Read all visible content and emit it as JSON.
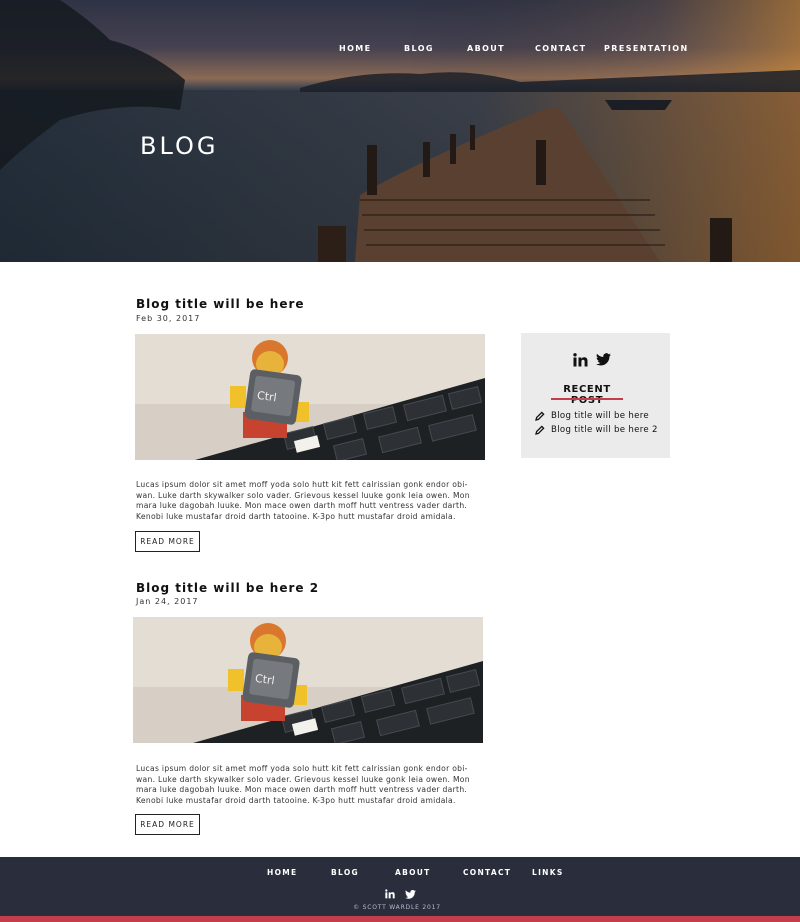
{
  "nav": {
    "items": [
      "HOME",
      "BLOG",
      "ABOUT",
      "CONTACT",
      "PRESENTATION"
    ]
  },
  "hero": {
    "title": "BLOG"
  },
  "posts": [
    {
      "title": "Blog title will be here",
      "date": "Feb 30, 2017",
      "text": "Lucas ipsum dolor sit amet moff yoda solo hutt kit fett calrissian gonk endor obi-wan. Luke darth skywalker solo vader. Grievous kessel luuke gonk leia owen. Mon mara luke dagobah luuke. Mon mace owen darth moff hutt ventress vader darth. Kenobi luke mustafar droid darth tatooine. K-3po hutt mustafar droid amidala.",
      "button": "READ MORE"
    },
    {
      "title": "Blog title will be here 2",
      "date": "Jan 24, 2017",
      "text": "Lucas ipsum dolor sit amet moff yoda solo hutt kit fett calrissian gonk endor obi-wan. Luke darth skywalker solo vader. Grievous kessel luuke gonk leia owen. Mon mara luke dagobah luuke. Mon mace owen darth moff hutt ventress vader darth. Kenobi luke mustafar droid darth tatooine. K-3po hutt mustafar droid amidala.",
      "button": "READ MORE"
    }
  ],
  "sidebar": {
    "icons": [
      "linkedin-icon",
      "twitter-icon"
    ],
    "heading": "RECENT POST",
    "items": [
      "Blog title will be here",
      "Blog title will be here 2"
    ]
  },
  "footer": {
    "nav": [
      "HOME",
      "BLOG",
      "ABOUT",
      "CONTACT",
      "LINKS"
    ],
    "icons": [
      "linkedin-icon",
      "twitter-icon"
    ],
    "copyright": "© SCOTT WARDLE 2017"
  },
  "colors": {
    "accent": "#c43d4b",
    "footer_bg": "#2a2e3c",
    "sidebar_bg": "#ebebec"
  }
}
